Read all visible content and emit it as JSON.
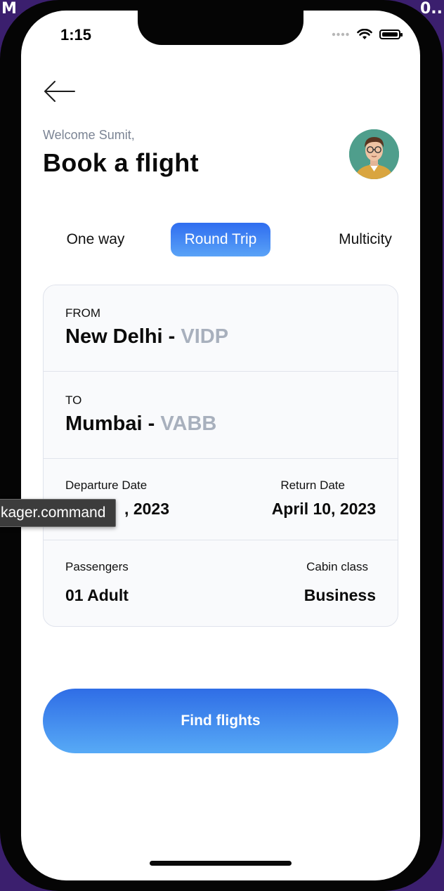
{
  "desktop": {
    "corner_left": "M",
    "corner_right": "0.."
  },
  "status_bar": {
    "time": "1:15"
  },
  "header": {
    "welcome": "Welcome Sumit,",
    "title": "Book a flight"
  },
  "trip_tabs": [
    {
      "label": "One way",
      "active": false
    },
    {
      "label": "Round Trip",
      "active": true
    },
    {
      "label": "Multicity",
      "active": false
    }
  ],
  "route": {
    "from_label": "FROM",
    "from_city": "New Delhi -",
    "from_code": "VIDP",
    "to_label": "TO",
    "to_city": "Mumbai -",
    "to_code": "VABB"
  },
  "dates": {
    "departure_label": "Departure Date",
    "departure_value": ", 2023",
    "return_label": "Return Date",
    "return_value": "April 10, 2023"
  },
  "travellers": {
    "passengers_label": "Passengers",
    "passengers_value": "01 Adult",
    "cabin_label": "Cabin class",
    "cabin_value": "Business"
  },
  "tooltip": {
    "text": "kager.command"
  },
  "actions": {
    "find_label": "Find flights"
  },
  "colors": {
    "accent_start": "#2f6df0",
    "accent_end": "#5aa3f7",
    "muted_code": "#a8b0bd"
  }
}
